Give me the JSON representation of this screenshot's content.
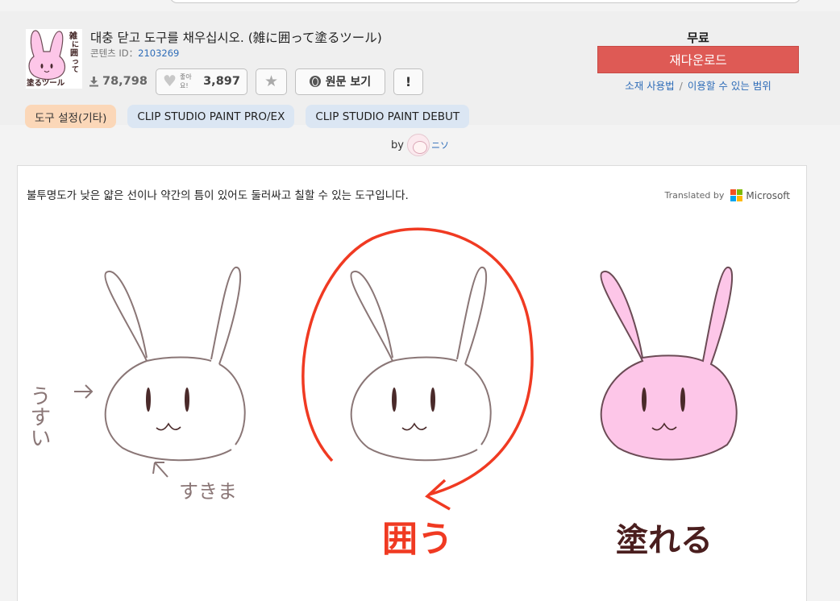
{
  "header": {
    "thumbnail_text": "雑に囲って塗るツール",
    "title": "대충 닫고 도구를 채우십시오. (雑に囲って塗るツール)",
    "content_id_label": "콘텐츠 ID：",
    "content_id_value": "2103269",
    "downloads": "78,798",
    "like_small": "좋아요!",
    "likes": "3,897",
    "view_original": "원문 보기",
    "report": "!",
    "tags": [
      "도구 설정(기타)",
      "CLIP STUDIO PAINT PRO/EX",
      "CLIP STUDIO PAINT DEBUT"
    ]
  },
  "purchase": {
    "price": "무료",
    "redownload": "재다운로드",
    "usage_link": "소재 사용법",
    "separator": "/",
    "range_link": "이용할 수 있는 범위"
  },
  "byline": {
    "by": "by",
    "author": "ニソ"
  },
  "content": {
    "description": "불투명도가 낮은 얇은 선이나 약간의 틈이 있어도 둘러싸고 칠할 수 있는 도구입니다.",
    "translated_by": "Translated by",
    "translator": "Microsoft",
    "illustration": {
      "label_thin": "うすい",
      "label_gap": "すきま",
      "label_enclose": "囲う",
      "label_fill": "塗れる"
    }
  },
  "colors": {
    "accent_red": "#de5a55",
    "link_blue": "#2f6db8",
    "tag_orange": "#fbd7b8",
    "tag_blue": "#dbe6f3",
    "bunny_pink": "#fdc6e8",
    "arrow_red": "#f03a22"
  }
}
